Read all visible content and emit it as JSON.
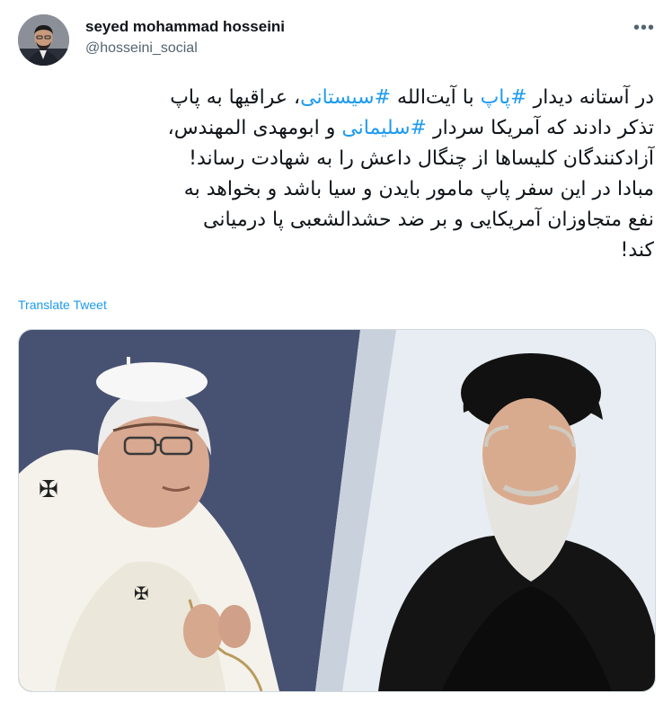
{
  "author": {
    "name": "seyed mohammad hosseini",
    "handle": "@hosseini_social"
  },
  "tweet": {
    "lines": [
      [
        {
          "t": "در آستانه دیدار ",
          "tag": false
        },
        {
          "t": "#پاپ",
          "tag": true
        },
        {
          "t": " با آیت‌الله ",
          "tag": false
        },
        {
          "t": "#سیستانی",
          "tag": true
        },
        {
          "t": "، عراقیها به پاپ",
          "tag": false
        }
      ],
      [
        {
          "t": "تذکر دادند که آمریکا سردار ",
          "tag": false
        },
        {
          "t": "#سلیمانی",
          "tag": true
        },
        {
          "t": " و ابومهدی المهندس،",
          "tag": false
        }
      ],
      [
        {
          "t": "آزادکنندگان کلیساها از چنگال داعش را به شهادت رساند!",
          "tag": false
        }
      ],
      [
        {
          "t": "مبادا در این سفر پاپ مامور بایدن و سیا باشد و بخواهد به",
          "tag": false
        }
      ],
      [
        {
          "t": "نفع متجاوزان آمریکایی و بر ضد حشدالشعبی پا درمیانی",
          "tag": false
        }
      ],
      [
        {
          "t": "کند!",
          "tag": false
        }
      ]
    ]
  },
  "translate_label": "Translate Tweet",
  "more_icon": "more-horizontal-icon",
  "media": {
    "description_icon": "photo-image",
    "colors": {
      "left_bg": "#3c4563",
      "right_bg": "#e8edf3",
      "robe_white": "#f4f2ea",
      "turban_black": "#151515",
      "skin": "#d9ab8e",
      "beard": "#e6e4df"
    }
  },
  "colors": {
    "accent": "#1d9bf0",
    "text": "#0f1419",
    "secondary": "#536471",
    "border": "#cfd9de"
  }
}
